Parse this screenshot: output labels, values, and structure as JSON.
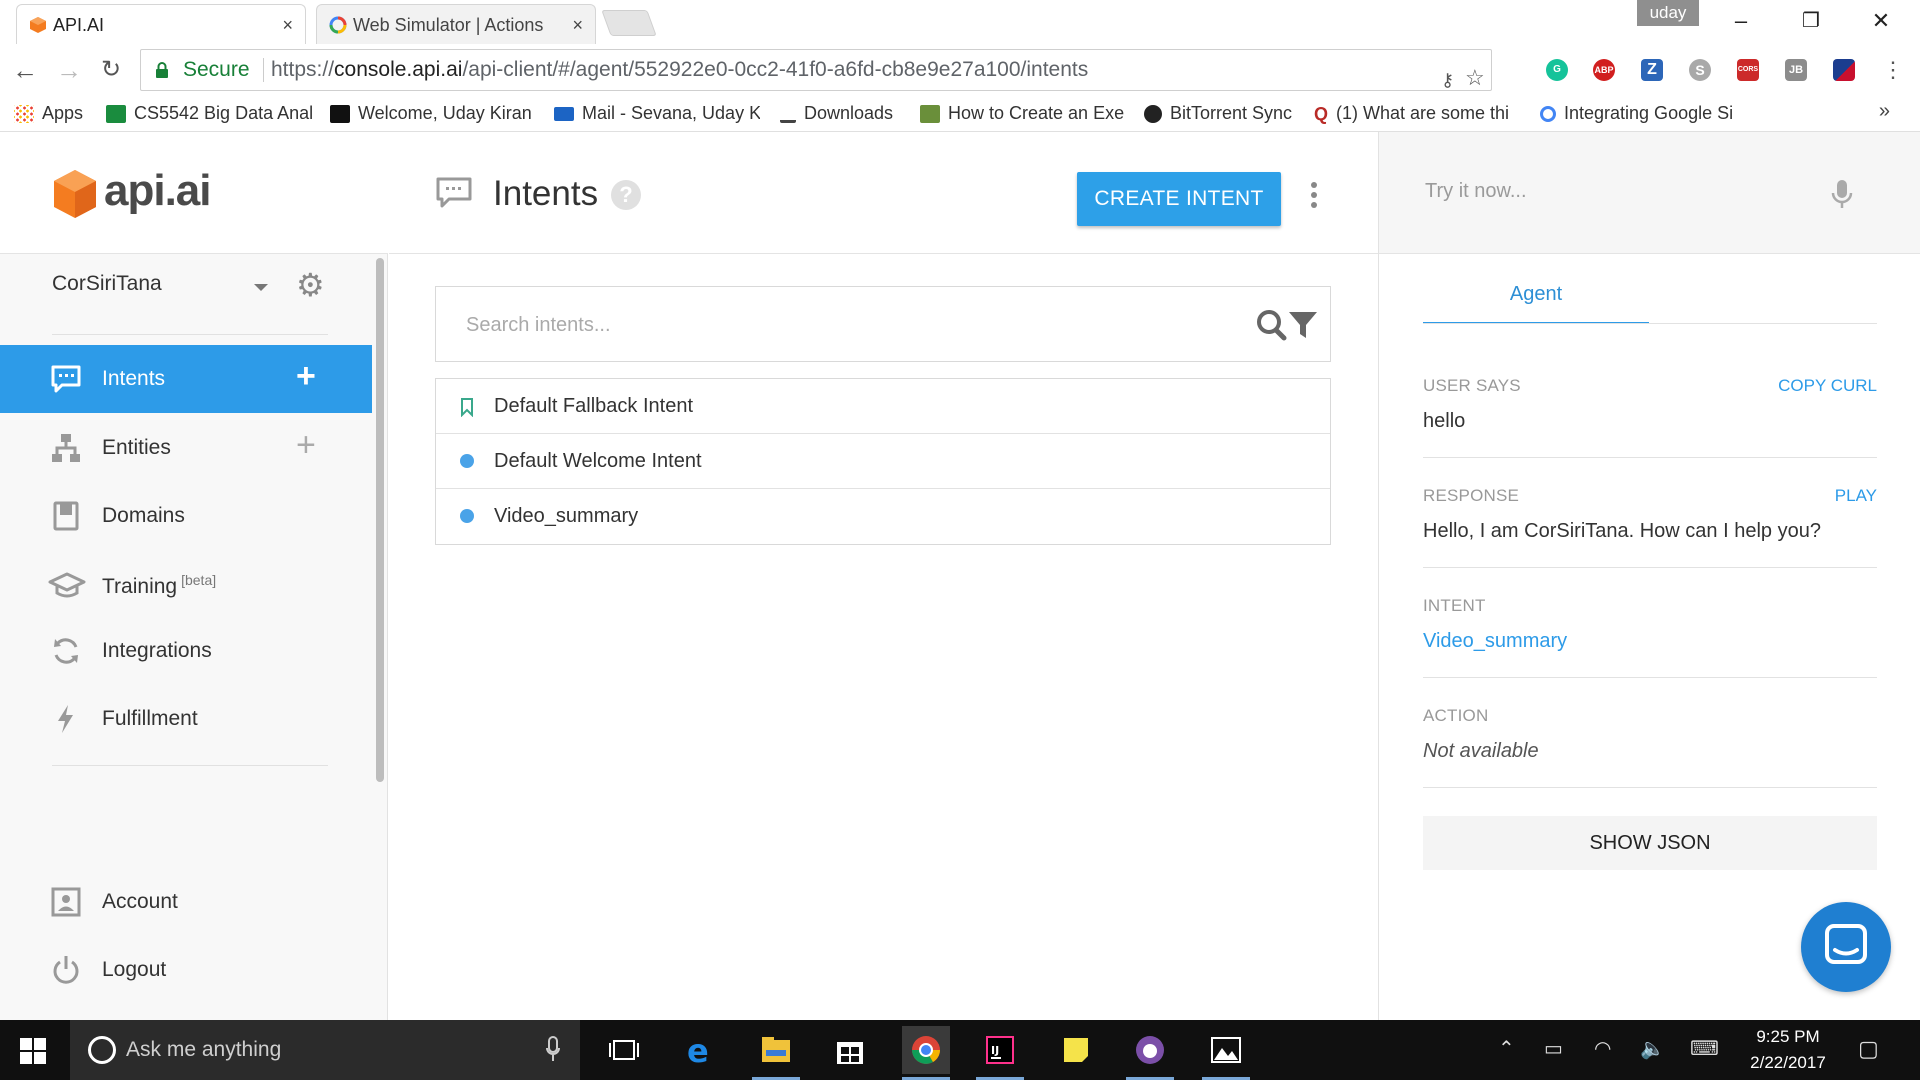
{
  "browser": {
    "tabs": [
      {
        "title": "API.AI",
        "close": "×"
      },
      {
        "title": "Web Simulator | Actions",
        "close": "×"
      }
    ],
    "user_badge": "uday",
    "window_controls": {
      "minimize": "–",
      "maximize": "❐",
      "close": "✕"
    },
    "security_label": "Secure",
    "url_scheme": "https://",
    "url_host": "console.api.ai",
    "url_path": "/api-client/#/agent/552922e0-0cc2-41f0-a6fd-cb8e9e27a100/intents",
    "extensions": [
      {
        "icon": "grammarly-icon",
        "text": "G",
        "color": "#15c39a"
      },
      {
        "icon": "adblock-plus-icon",
        "text": "ABP",
        "color": "#d11f1f"
      },
      {
        "icon": "zotero-icon",
        "text": "Z",
        "color": "#2c66b8"
      },
      {
        "icon": "skype-icon",
        "text": "S",
        "color": "#a9a9a9"
      },
      {
        "icon": "cors-icon",
        "text": "CORS",
        "color": "#cc2a2a"
      },
      {
        "icon": "jetbrains-icon",
        "text": "JB",
        "color": "#8c8c8c"
      },
      {
        "icon": "flag-icon",
        "text": "",
        "color": "#1b3d8f"
      }
    ],
    "bookmarks": [
      {
        "label": "Apps",
        "icon_color": "#e94235"
      },
      {
        "label": "CS5542 Big Data Anal",
        "icon_color": "#1a8c3e"
      },
      {
        "label": "Welcome, Uday Kiran",
        "icon_color": "#111111"
      },
      {
        "label": "Mail - Sevana, Uday K",
        "icon_color": "#1c64c4"
      },
      {
        "label": "Downloads",
        "icon_color": "#444444"
      },
      {
        "label": "How to Create an Exe",
        "icon_color": "#6a8f3a"
      },
      {
        "label": "BitTorrent Sync",
        "icon_color": "#222222"
      },
      {
        "label": "(1) What are some thi",
        "icon_color": "#b92b27"
      },
      {
        "label": "Integrating Google Si",
        "icon_color": "#4285f4"
      }
    ],
    "bookmarks_more": "»"
  },
  "sidebar": {
    "logo_text": "api.ai",
    "agent_name": "CorSiriTana",
    "items": [
      {
        "label": "Intents",
        "icon": "intents-icon",
        "plus": "+"
      },
      {
        "label": "Entities",
        "icon": "entities-icon",
        "plus": "+"
      },
      {
        "label": "Domains",
        "icon": "domains-icon"
      },
      {
        "label": "Training",
        "icon": "training-icon",
        "badge": "[beta]"
      },
      {
        "label": "Integrations",
        "icon": "integrations-icon"
      },
      {
        "label": "Fulfillment",
        "icon": "fulfillment-icon"
      },
      {
        "label": "Account",
        "icon": "account-icon"
      },
      {
        "label": "Logout",
        "icon": "logout-icon"
      }
    ]
  },
  "main": {
    "title": "Intents",
    "help": "?",
    "create_button": "CREATE INTENT",
    "search_placeholder": "Search intents...",
    "intents": [
      {
        "label": "Default Fallback Intent",
        "marker": "bookmark"
      },
      {
        "label": "Default Welcome Intent",
        "marker": "dot"
      },
      {
        "label": "Video_summary",
        "marker": "dot"
      }
    ]
  },
  "console": {
    "try_placeholder": "Try it now...",
    "tab": "Agent",
    "user_says_label": "USER SAYS",
    "copy_curl": "COPY CURL",
    "user_says": "hello",
    "response_label": "RESPONSE",
    "play": "PLAY",
    "response": "Hello, I am CorSiriTana. How can I help you?",
    "intent_label": "INTENT",
    "intent": "Video_summary",
    "action_label": "ACTION",
    "action": "Not available",
    "show_json": "SHOW JSON"
  },
  "taskbar": {
    "search_placeholder": "Ask me anything",
    "time": "9:25 PM",
    "date": "2/22/2017"
  },
  "colors": {
    "accent": "#2d9be8",
    "logo_orange": "#f47c20"
  }
}
